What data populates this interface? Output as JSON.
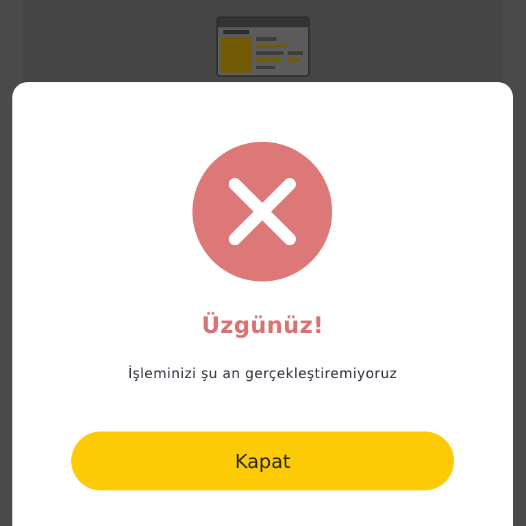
{
  "dialog": {
    "title": "Üzgünüz!",
    "message": "İşleminizi şu an gerçekleştiremiyoruz",
    "close_label": "Kapat",
    "status_icon": "close-x-icon"
  },
  "colors": {
    "overlay": "#4a4a4a",
    "dialog_background": "#ffffff",
    "error_circle": "#dc7878",
    "title_text": "#d97373",
    "message_text": "#2b2f3a",
    "button": "#fccb05",
    "button_text": "#262626"
  }
}
